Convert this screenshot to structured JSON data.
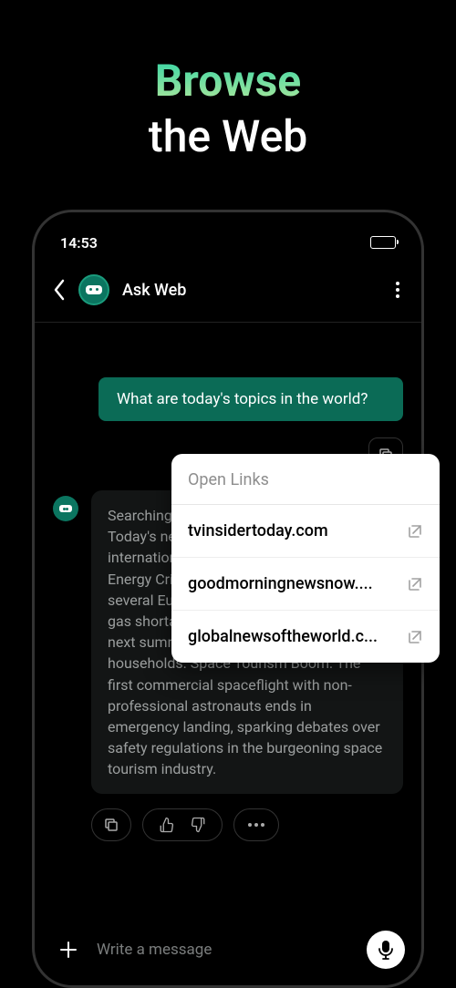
{
  "promo": {
    "line1": "Browse",
    "line2": "the Web"
  },
  "status": {
    "time": "14:53"
  },
  "header": {
    "title": "Ask Web"
  },
  "chat": {
    "user_message": "What are today's topics in the world?",
    "bot_message": "Searching for \"today's top news topics\"...\nToday's news covers a wide range of international topics including:\nGlobal Energy Crisis: As winter approaches, several European nations warn of potential gas shortages and rolling blackouts by next summer, affecting millions of households.\nSpace Tourism Boom: The first commercial spaceflight with non-professional astronauts ends in emergency landing, sparking debates over safety regulations in the burgeoning space tourism industry."
  },
  "popup": {
    "title": "Open Links",
    "items": [
      {
        "label": "tvinsidertoday.com"
      },
      {
        "label": "goodmorningnewsnow...."
      },
      {
        "label": "globalnewsoftheworld.c..."
      }
    ]
  },
  "composer": {
    "placeholder": "Write a message"
  }
}
